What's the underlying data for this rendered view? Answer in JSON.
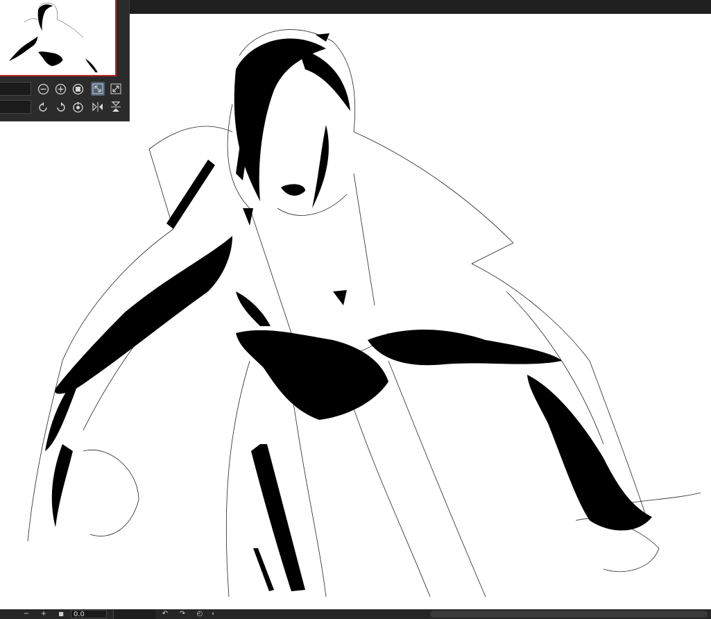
{
  "window": {
    "background": "#ffffff",
    "chrome": "#1f1f1f"
  },
  "navigator": {
    "accent_color": "#c0262b",
    "buttons_row1": [
      {
        "name": "zoom-out-icon",
        "glyph": "⊖"
      },
      {
        "name": "zoom-in-icon",
        "glyph": "⊕"
      },
      {
        "name": "actual-size-icon",
        "glyph": "■"
      },
      {
        "name": "fit-view-icon",
        "glyph": "⤡",
        "active": true
      },
      {
        "name": "fit-window-icon",
        "glyph": "⤡"
      }
    ],
    "buttons_row2": [
      {
        "name": "rotate-left-icon",
        "glyph": "↶"
      },
      {
        "name": "rotate-right-icon",
        "glyph": "↷"
      },
      {
        "name": "reset-rotation-icon",
        "glyph": "◴"
      },
      {
        "name": "flip-horizontal-icon",
        "glyph": "⧓"
      },
      {
        "name": "flip-vertical-icon",
        "glyph": "⧗"
      }
    ]
  },
  "bottom_bar": {
    "zoom_out_label": "−",
    "zoom_in_label": "+",
    "fit_label": "■",
    "zoom_value": "0.0",
    "rotate_left_label": "↶",
    "rotate_right_label": "↷",
    "reset_rotation_label": "◴",
    "scroll_left_label": "‹"
  }
}
